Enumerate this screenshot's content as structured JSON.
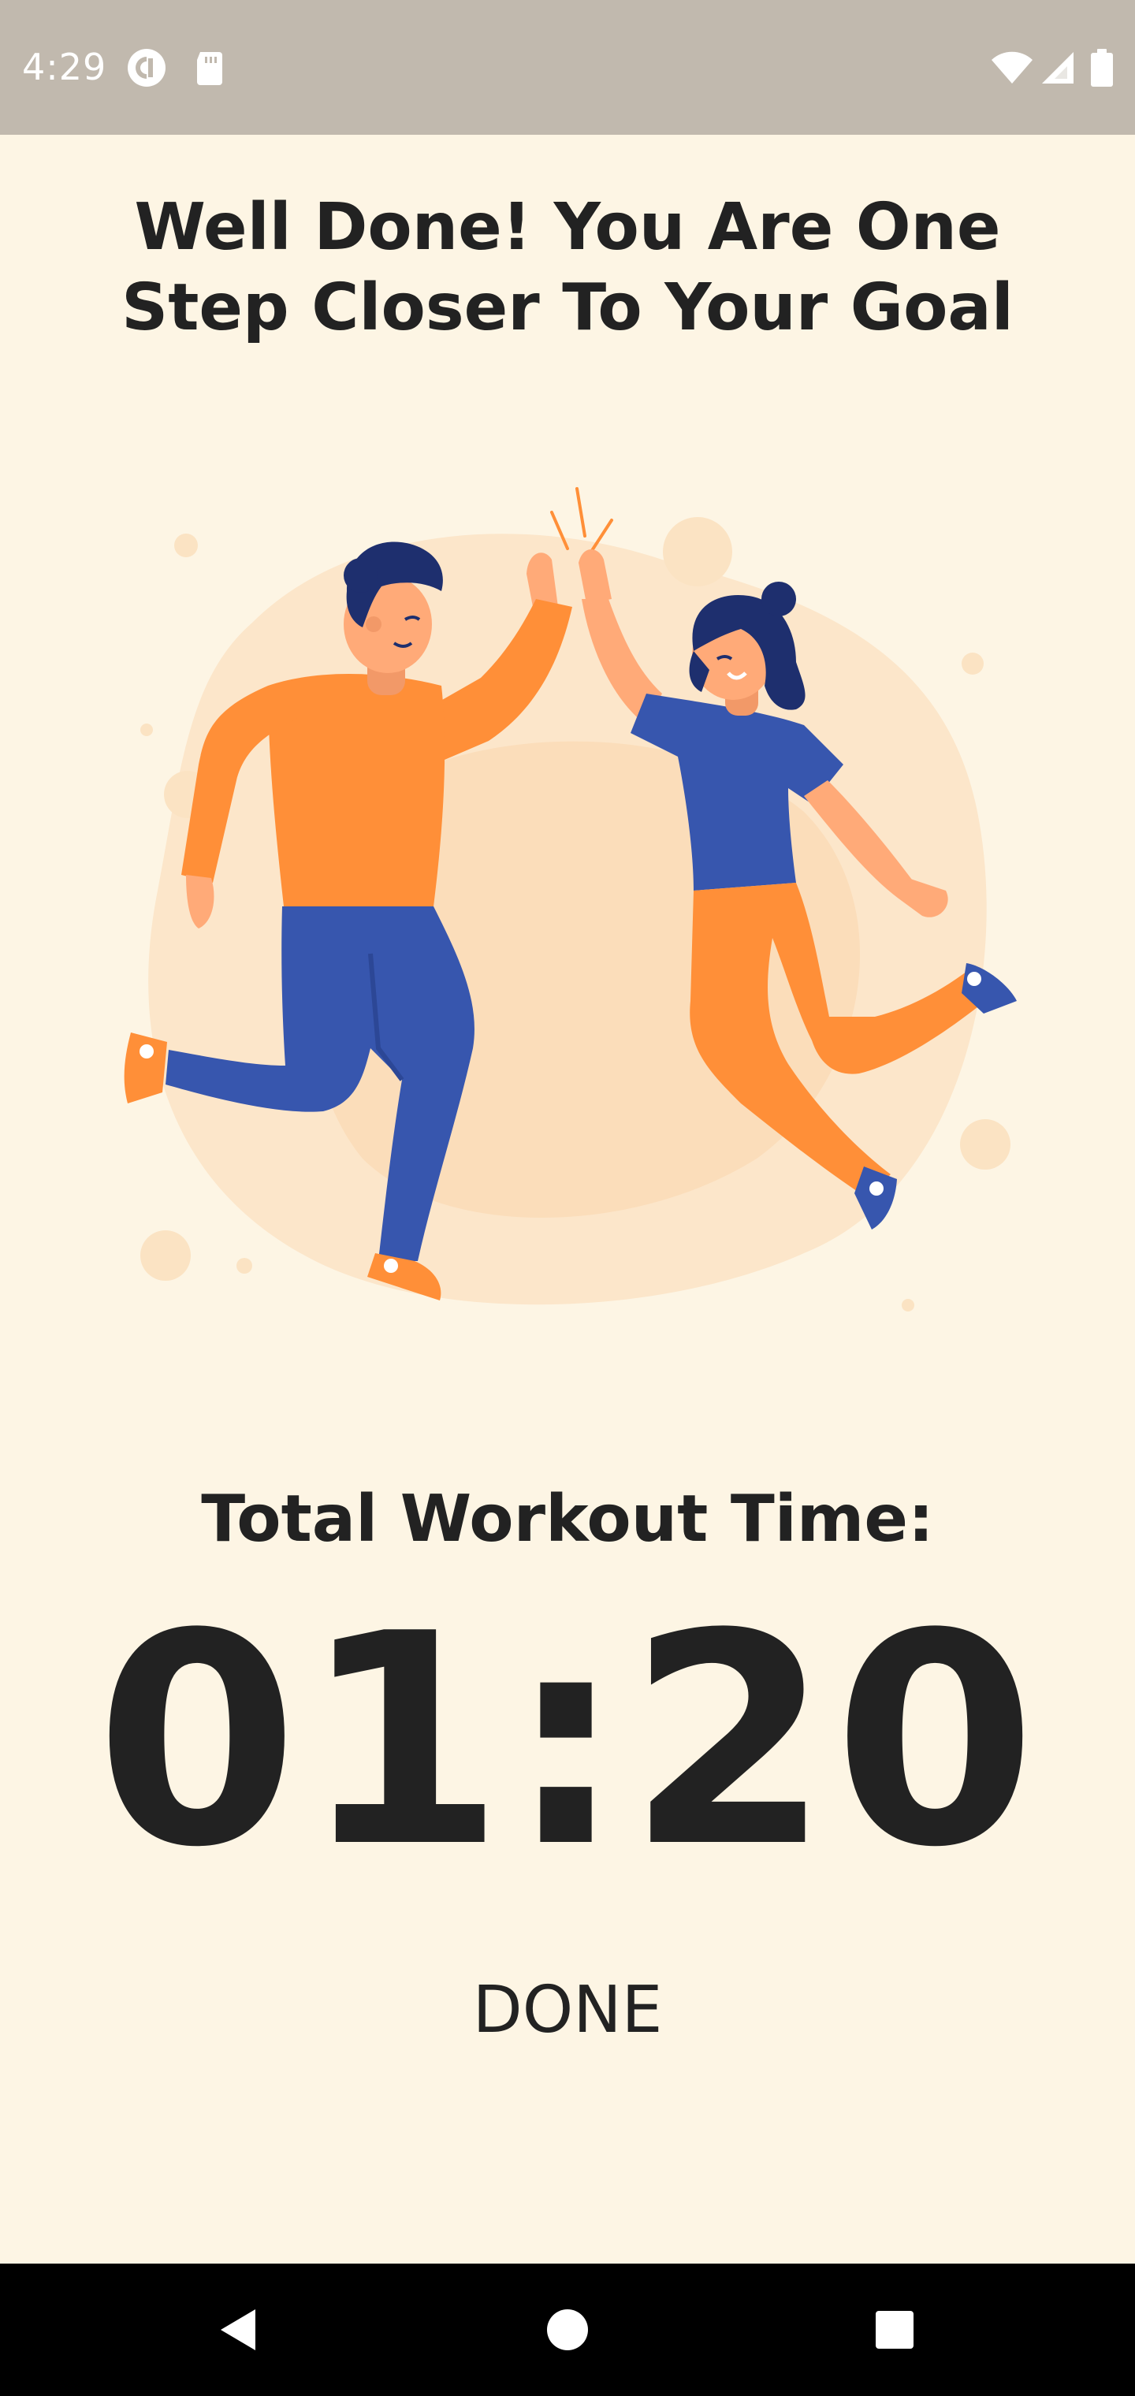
{
  "status_bar": {
    "time": "4:29",
    "left_icons": [
      "pocket-casts-icon",
      "sd-card-icon"
    ],
    "right_icons": [
      "wifi-icon",
      "cellular-signal-icon",
      "battery-icon"
    ]
  },
  "screen": {
    "title": "Well Done! You Are One Step Closer To Your Goal",
    "illustration": "two-people-high-five-illustration",
    "workout_label": "Total Workout Time:",
    "workout_time": "01:20",
    "done_label": "DONE"
  },
  "nav_bar": {
    "buttons": [
      "back-icon",
      "home-icon",
      "recents-icon"
    ]
  },
  "colors": {
    "background": "#FDF5E4",
    "status_bar": "#C1B9AE",
    "text": "#222222",
    "orange": "#FF8F38",
    "blue": "#3756AE",
    "navy": "#1E2F6E",
    "skin": "#FFAA78"
  }
}
